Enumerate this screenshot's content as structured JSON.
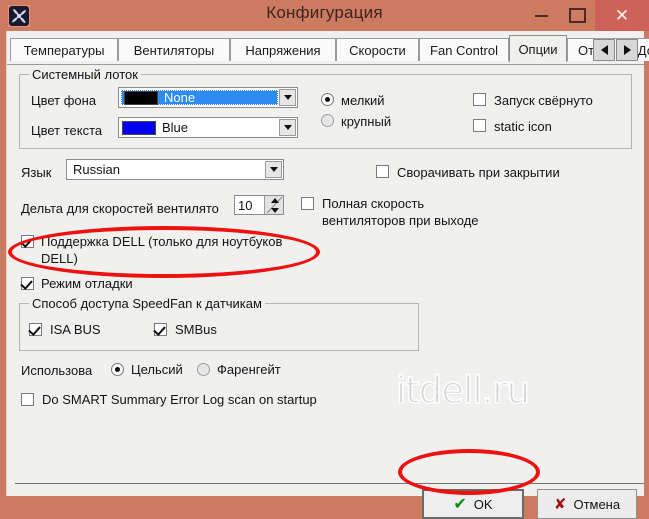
{
  "window": {
    "title": "Конфигурация",
    "icon": "fan-icon",
    "controls": {
      "minimize": "–",
      "maximize": "□",
      "close": "✕"
    },
    "close_color": "#cf6258",
    "frame_color": "#cd7b60"
  },
  "tabs": {
    "items": [
      {
        "label": "Температуры",
        "selected": false
      },
      {
        "label": "Вентиляторы",
        "selected": false
      },
      {
        "label": "Напряжения",
        "selected": false
      },
      {
        "label": "Скорости",
        "selected": false
      },
      {
        "label": "Fan Control",
        "selected": false
      },
      {
        "label": "Опции",
        "selected": true
      },
      {
        "label": "Отчёт",
        "selected": false
      },
      {
        "label": "Допо",
        "selected": false
      }
    ],
    "scroll_left": "◀",
    "scroll_right": "▶"
  },
  "tray_group": {
    "title": "Системный лоток",
    "bg_color_label": "Цвет фона",
    "bg_color_value": "None",
    "bg_color_swatch": "#000000",
    "text_color_label": "Цвет текста",
    "text_color_value": "Blue",
    "text_color_swatch": "#0000ee",
    "icon_size": {
      "small_label": "мелкий",
      "small_selected": true,
      "large_label": "крупный",
      "large_selected": false
    },
    "start_minimized": {
      "label": "Запуск свёрнуто",
      "checked": false
    },
    "static_icon": {
      "label": "static icon",
      "checked": false
    }
  },
  "language": {
    "label": "Язык",
    "value": "Russian"
  },
  "fan_delta": {
    "label": "Дельта для скоростей вентилято",
    "value": "10"
  },
  "full_speed_on_exit": {
    "line1": "Полная скорость",
    "line2": "вентиляторов при выходе",
    "checked": false
  },
  "minimize_on_close": {
    "label": "Сворачивать при закрытии",
    "checked": false
  },
  "dell_support": {
    "line1": "Поддержка DELL (только для ноутбуков",
    "line2": "DELL)",
    "checked": true,
    "highlight_color": "#ee1111"
  },
  "debug_mode": {
    "label": "Режим отладки",
    "checked": true
  },
  "access_group": {
    "title": "Способ доступа SpeedFan к датчикам",
    "isa_bus": {
      "label": "ISA BUS",
      "checked": true
    },
    "smbus": {
      "label": "SMBus",
      "checked": true
    }
  },
  "temperature_units": {
    "label": "Использова",
    "celsius": {
      "label": "Цельсий",
      "selected": true
    },
    "fahrenheit": {
      "label": "Фаренгейт",
      "selected": false
    }
  },
  "smart_scan": {
    "label": "Do SMART Summary Error Log scan on startup",
    "checked": false
  },
  "watermark": {
    "text": "itdell.ru"
  },
  "buttons": {
    "ok": {
      "label": "OK",
      "icon": "check-icon",
      "icon_color": "#0a8a13",
      "highlighted": true
    },
    "cancel": {
      "label": "Отмена",
      "icon": "x-icon",
      "icon_color": "#9e1313"
    }
  }
}
